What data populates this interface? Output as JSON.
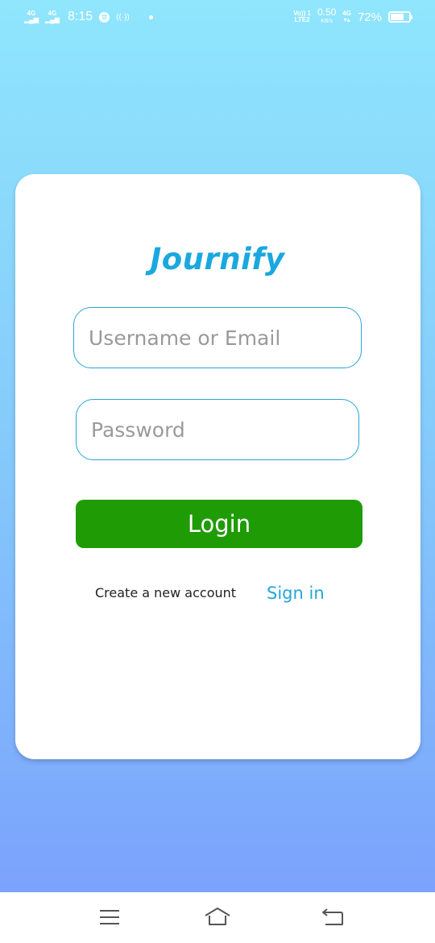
{
  "status_bar": {
    "sim1": "4G",
    "sim2": "4G",
    "time": "8:15",
    "volte": "Vo)) 1",
    "lte": "LTE2",
    "speed_value": "0.50",
    "speed_unit": "KB/s",
    "network": "4G",
    "battery_percent_text": "72%",
    "battery_level": 0.72
  },
  "app": {
    "logo": "Journify"
  },
  "form": {
    "username_placeholder": "Username or Email",
    "password_placeholder": "Password",
    "login_label": "Login",
    "create_account_label": "Create a new account",
    "signin_label": "Sign in"
  },
  "colors": {
    "accent": "#1aa8de",
    "login_button": "#1f9c05",
    "gradient_top": "#8fe6fd",
    "gradient_bottom": "#7a9efd"
  },
  "nav": {
    "icons": [
      "menu-icon",
      "home-icon",
      "back-icon"
    ]
  }
}
